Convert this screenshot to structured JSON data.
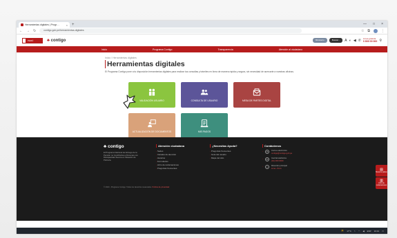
{
  "browser": {
    "tab_title": "Herramientas digitales | Progr…",
    "tab_close": "×",
    "new_tab": "+",
    "url": "contigo.gob.pe/herramientas-digitales",
    "window_controls": [
      "—",
      "□",
      "×"
    ],
    "nav_icons": [
      "←",
      "→",
      "↻"
    ]
  },
  "header": {
    "gob_label": "PERÚ",
    "site_logo": "contigo",
    "pill_1": "Ministerio",
    "pill_2": "Buscar...",
    "call_title": "Línea gratuita",
    "call_number": "0 800 00 000"
  },
  "menu": {
    "items": [
      "Inicio",
      "Programa Contigo",
      "Transparencia",
      "Atención al ciudadano"
    ]
  },
  "main": {
    "breadcrumb": "Inicio / Herramientas digitales",
    "title": "Herramientas digitales",
    "intro": "El Programa Contigo pone a tu disposición herramientas digitales para realizar tus consultas y trámites en línea de manera rápida y segura, sin necesidad de acercarte a nuestras oficinas.",
    "tiles": [
      {
        "label": "Validación usuario",
        "color": "#8bc53f",
        "icon": "users-icon"
      },
      {
        "label": "Consulta de usuario",
        "color": "#5c5599",
        "icon": "people-card-icon"
      },
      {
        "label": "Mesa de partes digital",
        "color": "#a94442",
        "icon": "envelope-icon"
      },
      {
        "label": "Actualización de documentos",
        "color": "#d9a27a",
        "icon": "person-board-icon"
      },
      {
        "label": "Mis pagos",
        "color": "#3e8f7e",
        "icon": "document-icon"
      }
    ]
  },
  "footer": {
    "logo": "contigo",
    "description": "El Programa Nacional de Entrega de la Pensión no Contributiva a Personas con Discapacidad Severa en Situación de Pobreza.",
    "col1_title": "Atención ciudadana",
    "col1_items": [
      "Sedes",
      "Canales de atención",
      "Horarios",
      "Formularios",
      "Libro de reclamaciones",
      "Preguntas frecuentes"
    ],
    "col2_title": "¿Necesitas Ayuda?",
    "col2_items": [
      "Preguntas frecuentes",
      "Guía del usuario",
      "Mapa del sitio"
    ],
    "col3_title": "Contáctenos",
    "contacts": [
      {
        "icon": "✉",
        "text": "Correo electrónico",
        "link": "contigo@contigo.gob.pe"
      },
      {
        "icon": "☏",
        "text": "Central telefónica",
        "link": "(01) 000 0000"
      },
      {
        "icon": "⌂",
        "text": "Dirección principal",
        "link": "Lima - Perú"
      }
    ],
    "legal": "© 2023 - Programa Contigo. Todos los derechos reservados.",
    "legal_link": "Política de privacidad",
    "float_1": "Mesa de partes",
    "float_2": "Libro de reclamaciones"
  },
  "taskbar": {
    "weather": "17°C",
    "time": "10:42",
    "lang": "ESP"
  }
}
